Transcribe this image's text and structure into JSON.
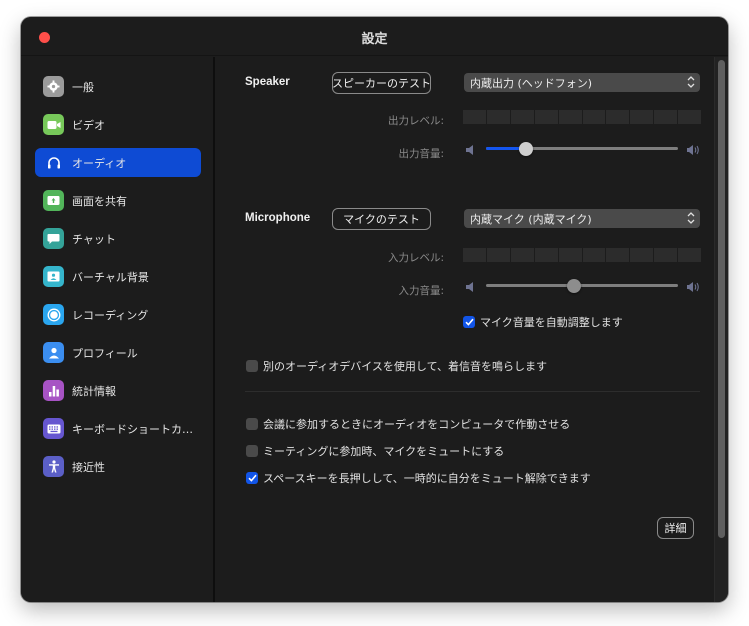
{
  "window": {
    "title": "設定"
  },
  "sidebar": {
    "active_index": 2,
    "items": [
      {
        "label": "一般",
        "icon": "gear-icon",
        "color": "#9b9b9b"
      },
      {
        "label": "ビデオ",
        "icon": "video-camera-icon",
        "color": "#77c85a"
      },
      {
        "label": "オーディオ",
        "icon": "headphones-icon",
        "color": "#0e4bd4"
      },
      {
        "label": "画面を共有",
        "icon": "share-screen-icon",
        "color": "#52b55a"
      },
      {
        "label": "チャット",
        "icon": "chat-bubble-icon",
        "color": "#34a399"
      },
      {
        "label": "バーチャル背景",
        "icon": "virtual-background-icon",
        "color": "#35b5cc"
      },
      {
        "label": "レコーディング",
        "icon": "record-icon",
        "color": "#2aa6ef"
      },
      {
        "label": "プロフィール",
        "icon": "profile-icon",
        "color": "#3b8ef0"
      },
      {
        "label": "統計情報",
        "icon": "statistics-icon",
        "color": "#a753c4"
      },
      {
        "label": "キーボードショートカ…",
        "icon": "keyboard-icon",
        "color": "#6656d0"
      },
      {
        "label": "接近性",
        "icon": "accessibility-icon",
        "color": "#5b5fc7"
      }
    ]
  },
  "speaker": {
    "section_label": "Speaker",
    "test_button": "スピーカーのテスト",
    "device": "内蔵出力 (ヘッドフォン)",
    "level_label": "出力レベル:",
    "level_segments": 10,
    "level_active": 0,
    "volume_label": "出力音量:",
    "volume_percent": 21,
    "volume_enabled": true
  },
  "microphone": {
    "section_label": "Microphone",
    "test_button": "マイクのテスト",
    "device": "内蔵マイク (内蔵マイク)",
    "level_label": "入力レベル:",
    "level_segments": 10,
    "level_active": 0,
    "volume_label": "入力音量:",
    "volume_percent": 46,
    "volume_enabled": false,
    "auto_adjust": {
      "label": "マイク音量を自動調整します",
      "checked": true
    }
  },
  "options": {
    "separate_ringtone": {
      "label": "別のオーディオデバイスを使用して、着信音を鳴らします",
      "checked": false
    },
    "join_computer_audio": {
      "label": "会議に参加するときにオーディオをコンピュータで作動させる",
      "checked": false
    },
    "mute_on_join": {
      "label": "ミーティングに参加時、マイクをミュートにする",
      "checked": false
    },
    "space_unmute": {
      "label": "スペースキーを長押しして、一時的に自分をミュート解除できます",
      "checked": true
    }
  },
  "advanced_button": "詳細",
  "colors": {
    "accent": "#0e4bd4",
    "checkbox_checked": "#1255e8",
    "window_bg": "#1c1c1c",
    "close_button": "#fe4f4a"
  }
}
